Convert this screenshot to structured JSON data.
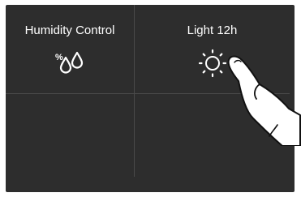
{
  "tiles": [
    {
      "label": "Humidity Control",
      "icon": "humidity-drops-icon"
    },
    {
      "label": "Light 12h",
      "icon": "sun-icon"
    }
  ],
  "pointer": {
    "icon": "pointing-hand-icon"
  },
  "colors": {
    "panel_background": "#2d2d2d",
    "divider": "#4a4a4a",
    "text": "#ffffff",
    "icon": "#ffffff"
  }
}
